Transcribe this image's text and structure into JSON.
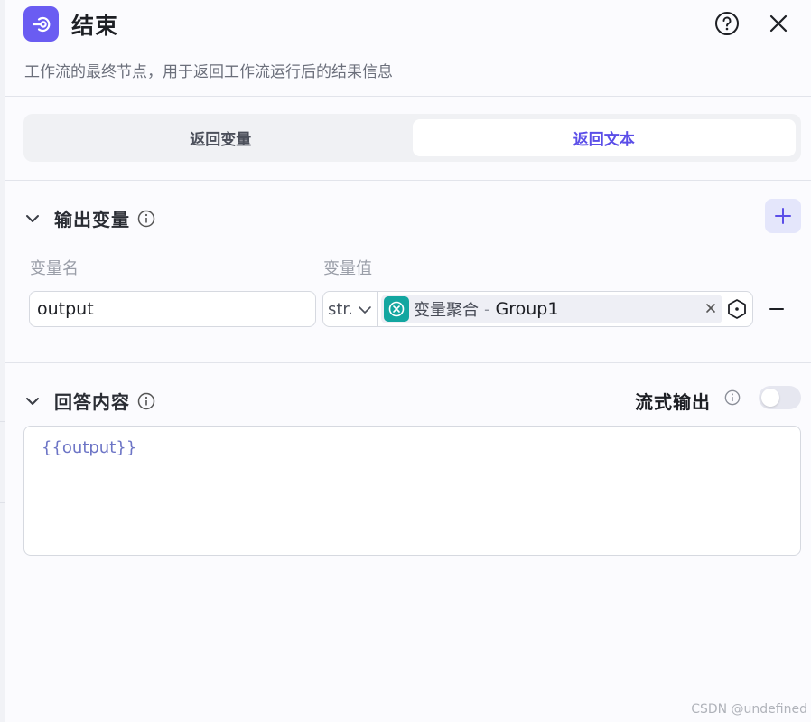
{
  "header": {
    "title": "结束",
    "icon": "end-node-icon",
    "description": "工作流的最终节点，用于返回工作流运行后的结果信息",
    "accent": "#6a5cf2"
  },
  "tabs": [
    {
      "label": "返回变量",
      "active": false
    },
    {
      "label": "返回文本",
      "active": true
    }
  ],
  "output_section": {
    "title": "输出变量",
    "col_name": "变量名",
    "col_value": "变量值",
    "row": {
      "name": "output",
      "type": "str.",
      "ref_node": "变量聚合",
      "ref_sep": "-",
      "ref_var": "Group1",
      "ref_icon_color": "#13a6a0"
    }
  },
  "answer_section": {
    "title": "回答内容",
    "stream_label": "流式输出",
    "stream_enabled": false,
    "content": "{{output}}"
  },
  "watermark": "CSDN @undefined"
}
